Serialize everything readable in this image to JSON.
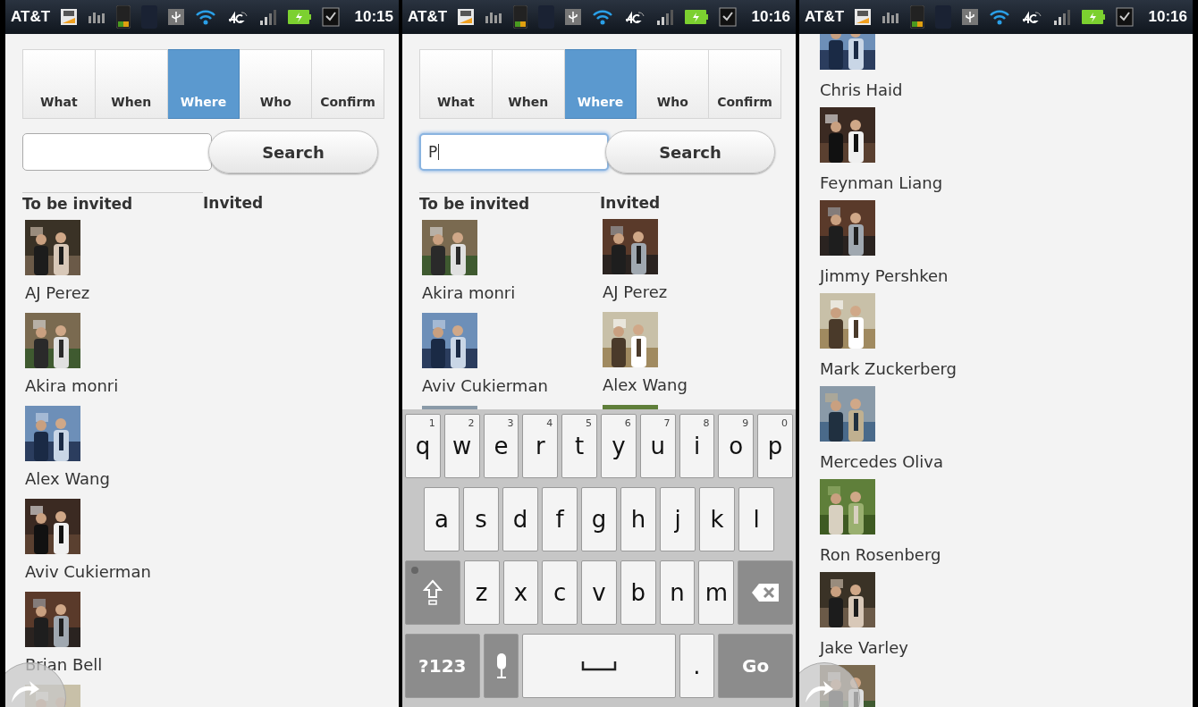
{
  "screens": [
    {
      "status_bar": {
        "carrier": "AT&T",
        "time": "10:15"
      },
      "tabs": [
        {
          "label": "What",
          "selected": false
        },
        {
          "label": "When",
          "selected": false
        },
        {
          "label": "Where",
          "selected": true
        },
        {
          "label": "Who",
          "selected": false
        },
        {
          "label": "Confirm",
          "selected": false
        }
      ],
      "search": {
        "focused": false,
        "button": "Search"
      },
      "columns": [
        {
          "heading": "To be invited",
          "underline": true,
          "people": [
            {
              "name": "AJ Perez"
            },
            {
              "name": "Akira monri"
            },
            {
              "name": "Alex Wang"
            },
            {
              "name": "Aviv Cukierman"
            },
            {
              "name": "Brian Bell"
            }
          ],
          "more_below": true
        },
        {
          "heading": "Invited",
          "underline": false
        }
      ],
      "back_button": true
    },
    {
      "status_bar": {
        "carrier": "AT&T",
        "time": "10:16"
      },
      "tabs": [
        {
          "label": "What",
          "selected": false
        },
        {
          "label": "When",
          "selected": false
        },
        {
          "label": "Where",
          "selected": true
        },
        {
          "label": "Who",
          "selected": false
        },
        {
          "label": "Confirm",
          "selected": false
        }
      ],
      "search": {
        "value": "P",
        "focused": true,
        "button": "Search"
      },
      "columns": [
        {
          "heading": "To be invited",
          "underline": true,
          "people": [
            {
              "name": "Akira monri"
            },
            {
              "name": "Aviv Cukierman"
            }
          ],
          "more_below": true
        },
        {
          "heading": "Invited",
          "underline": false,
          "people": [
            {
              "name": "AJ Perez"
            },
            {
              "name": "Alex Wang"
            }
          ],
          "more_below": true
        }
      ],
      "keyboard": {
        "rows": [
          [
            {
              "kind": "letter",
              "label": "q",
              "hint": "1"
            },
            {
              "kind": "letter",
              "label": "w",
              "hint": "2"
            },
            {
              "kind": "letter",
              "label": "e",
              "hint": "3"
            },
            {
              "kind": "letter",
              "label": "r",
              "hint": "4"
            },
            {
              "kind": "letter",
              "label": "t",
              "hint": "5"
            },
            {
              "kind": "letter",
              "label": "y",
              "hint": "6"
            },
            {
              "kind": "letter",
              "label": "u",
              "hint": "7"
            },
            {
              "kind": "letter",
              "label": "i",
              "hint": "8"
            },
            {
              "kind": "letter",
              "label": "o",
              "hint": "9"
            },
            {
              "kind": "letter",
              "label": "p",
              "hint": "0"
            }
          ],
          [
            {
              "kind": "letter",
              "label": "a"
            },
            {
              "kind": "letter",
              "label": "s"
            },
            {
              "kind": "letter",
              "label": "d"
            },
            {
              "kind": "letter",
              "label": "f"
            },
            {
              "kind": "letter",
              "label": "g"
            },
            {
              "kind": "letter",
              "label": "h"
            },
            {
              "kind": "letter",
              "label": "j"
            },
            {
              "kind": "letter",
              "label": "k"
            },
            {
              "kind": "letter",
              "label": "l"
            }
          ],
          [
            {
              "kind": "shift"
            },
            {
              "kind": "letter",
              "label": "z"
            },
            {
              "kind": "letter",
              "label": "x"
            },
            {
              "kind": "letter",
              "label": "c"
            },
            {
              "kind": "letter",
              "label": "v"
            },
            {
              "kind": "letter",
              "label": "b"
            },
            {
              "kind": "letter",
              "label": "n"
            },
            {
              "kind": "letter",
              "label": "m"
            },
            {
              "kind": "backspace"
            }
          ],
          [
            {
              "kind": "mode",
              "label": "?123"
            },
            {
              "kind": "mic"
            },
            {
              "kind": "space"
            },
            {
              "kind": "letter",
              "label": "."
            },
            {
              "kind": "action",
              "label": "Go"
            }
          ]
        ]
      }
    },
    {
      "status_bar": {
        "carrier": "AT&T",
        "time": "10:16"
      },
      "list": [
        {
          "name": "Chris Haid"
        },
        {
          "name": "Feynman Liang"
        },
        {
          "name": "Jimmy Pershken"
        },
        {
          "name": "Mark Zuckerberg"
        },
        {
          "name": "Mercedes Oliva"
        },
        {
          "name": "Ron Rosenberg"
        },
        {
          "name": "Jake Varley"
        }
      ],
      "list_more_below": true,
      "back_button": true
    }
  ]
}
